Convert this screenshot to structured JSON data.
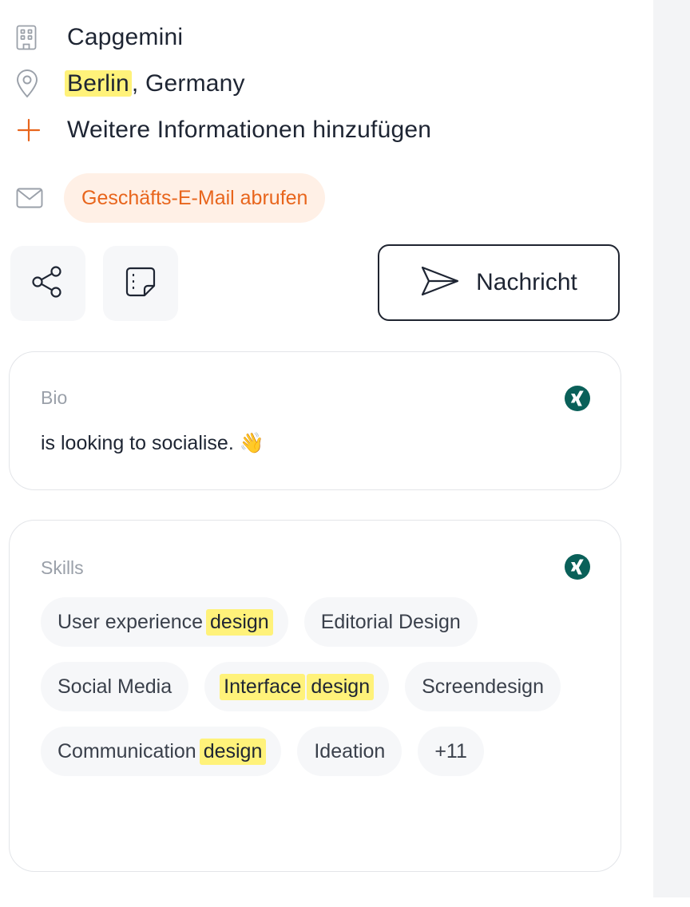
{
  "profile": {
    "company": "Capgemini",
    "location_city": "Berlin",
    "location_rest": ", Germany",
    "add_info_label": "Weitere Informationen hinzufügen",
    "email_button_label": "Geschäfts-E-Mail abrufen"
  },
  "actions": {
    "message_label": "Nachricht"
  },
  "bio": {
    "title": "Bio",
    "text": "is looking to socialise.",
    "emoji": "👋"
  },
  "skills": {
    "title": "Skills",
    "items": [
      {
        "parts": [
          {
            "text": "User experience",
            "highlight": false
          },
          {
            "text": "design",
            "highlight": true
          }
        ]
      },
      {
        "parts": [
          {
            "text": "Editorial Design",
            "highlight": false
          }
        ]
      },
      {
        "parts": [
          {
            "text": "Social Media",
            "highlight": false
          }
        ]
      },
      {
        "parts": [
          {
            "text": "Interface",
            "highlight": true
          },
          {
            "text": "design",
            "highlight": true
          }
        ]
      },
      {
        "parts": [
          {
            "text": "Screendesign",
            "highlight": false
          }
        ]
      },
      {
        "parts": [
          {
            "text": "Communication",
            "highlight": false
          },
          {
            "text": "design",
            "highlight": true
          }
        ]
      },
      {
        "parts": [
          {
            "text": "Ideation",
            "highlight": false
          }
        ]
      }
    ],
    "more_label": "+11"
  },
  "colors": {
    "accent_orange": "#e8651c",
    "highlight_yellow": "#fff27a",
    "xing_green": "#0a6059"
  },
  "icons": {
    "company": "building-icon",
    "location": "map-pin-icon",
    "add": "plus-icon",
    "email": "mail-icon",
    "share": "share-icon",
    "note": "sticky-note-icon",
    "send": "send-icon",
    "source": "xing-icon"
  }
}
